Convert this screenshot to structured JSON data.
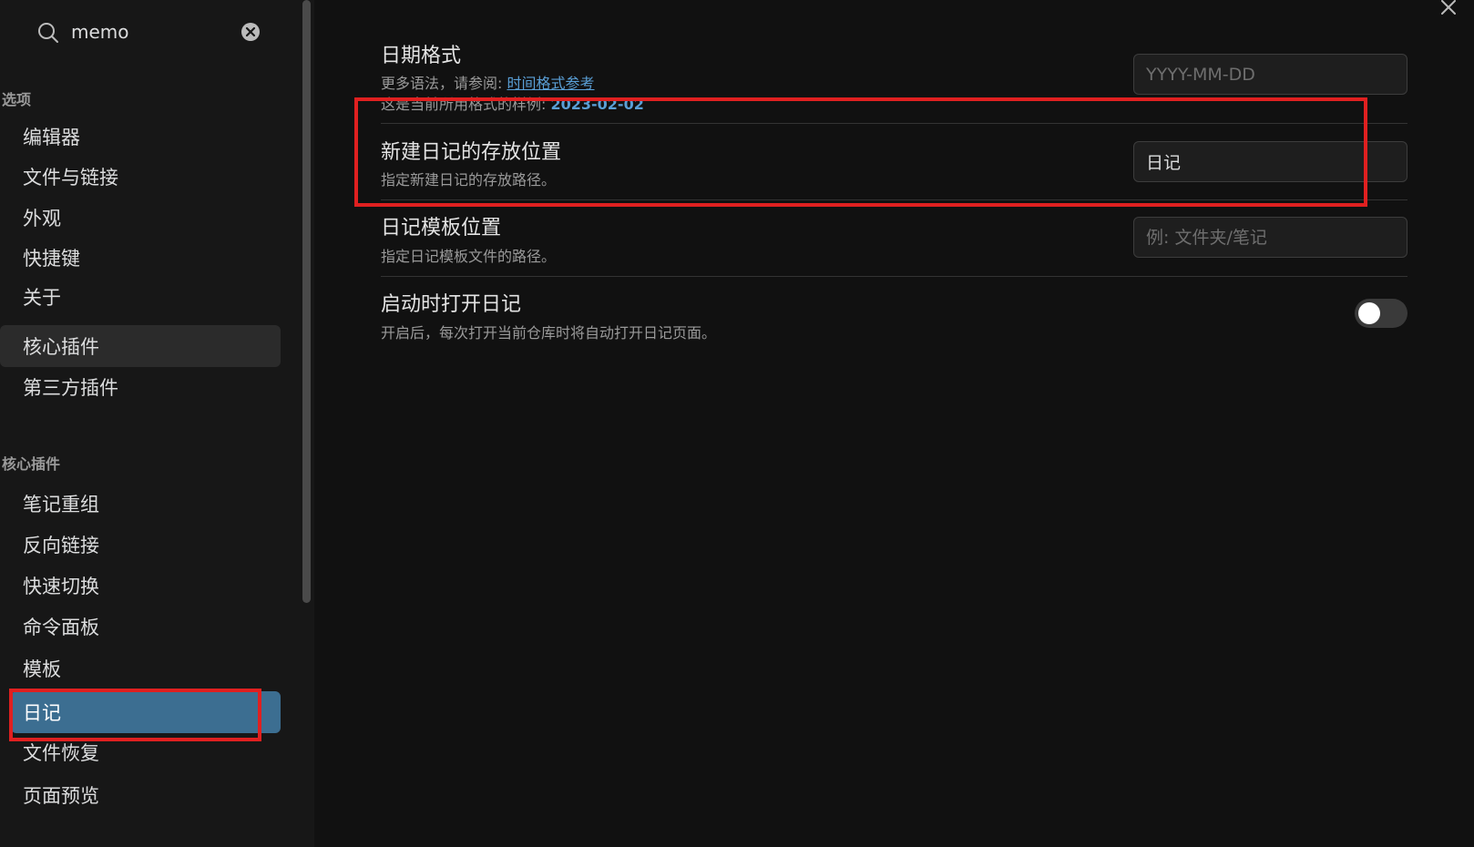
{
  "search": {
    "value": "memo",
    "placeholder": ""
  },
  "sidebar": {
    "options_title": "选项",
    "options_items": [
      {
        "label": "编辑器"
      },
      {
        "label": "文件与链接"
      },
      {
        "label": "外观"
      },
      {
        "label": "快捷键"
      },
      {
        "label": "关于"
      },
      {
        "label": "核心插件"
      },
      {
        "label": "第三方插件"
      }
    ],
    "core_title": "核心插件",
    "core_items": [
      {
        "label": "笔记重组"
      },
      {
        "label": "反向链接"
      },
      {
        "label": "快速切换"
      },
      {
        "label": "命令面板"
      },
      {
        "label": "模板"
      },
      {
        "label": "日记"
      },
      {
        "label": "文件恢复"
      },
      {
        "label": "页面预览"
      }
    ]
  },
  "settings": {
    "date_format": {
      "name": "日期格式",
      "desc_prefix": "更多语法，请参阅: ",
      "desc_link": "时间格式参考",
      "sample_prefix": "这是当前所用格式的样例: ",
      "sample_value": "2023-02-02",
      "placeholder": "YYYY-MM-DD",
      "value": ""
    },
    "new_location": {
      "name": "新建日记的存放位置",
      "desc": "指定新建日记的存放路径。",
      "value": "日记"
    },
    "template_location": {
      "name": "日记模板位置",
      "desc": "指定日记模板文件的路径。",
      "placeholder": "例: 文件夹/笔记",
      "value": ""
    },
    "open_on_start": {
      "name": "启动时打开日记",
      "desc": "开启后，每次打开当前仓库时将自动打开日记页面。",
      "enabled": false
    }
  },
  "colors": {
    "accent": "#3c6e91",
    "link": "#5a9fd6",
    "annotation": "#e02020"
  }
}
